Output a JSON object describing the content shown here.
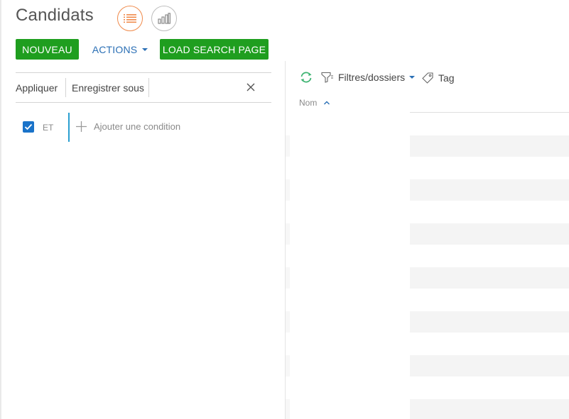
{
  "header": {
    "title": "Candidats",
    "view_list_icon": "list-icon",
    "view_chart_icon": "bar-chart-icon"
  },
  "toolbar": {
    "new_label": "NOUVEAU",
    "actions_label": "ACTIONS",
    "load_search_label": "LOAD SEARCH PAGE"
  },
  "filter_panel": {
    "apply_label": "Appliquer",
    "save_as_label": "Enregistrer sous",
    "close_icon": "close-icon",
    "logic_operator": "ET",
    "add_condition_label": "Ajouter une condition",
    "checkbox_checked": true
  },
  "grid_toolbar": {
    "refresh_icon": "refresh-icon",
    "filters_label": "Filtres/dossiers",
    "tag_label": "Tag"
  },
  "grid": {
    "columns": [
      {
        "label": "Nom",
        "sort": "ascending"
      }
    ],
    "row_count_visible": 7
  },
  "colors": {
    "accent_green": "#1f9e1f",
    "link_blue": "#2a6fb5",
    "active_orange": "#f08a4b",
    "checkbox_blue": "#1a73c9",
    "refresh_green": "#3cb371"
  }
}
